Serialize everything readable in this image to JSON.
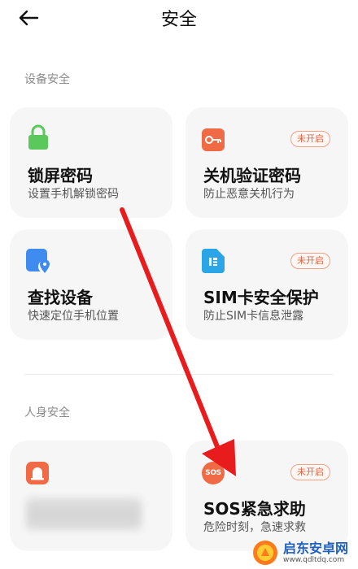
{
  "header": {
    "title": "安全"
  },
  "sections": [
    {
      "label": "设备安全"
    },
    {
      "label": "人身安全"
    }
  ],
  "cards": [
    {
      "title": "锁屏密码",
      "desc": "设置手机解锁密码",
      "badge": null,
      "icon": "lock-icon",
      "color": "#5ac85a"
    },
    {
      "title": "关机验证密码",
      "desc": "防止恶意关机行为",
      "badge": "未开启",
      "icon": "key-icon",
      "color": "#ef6a45"
    },
    {
      "title": "查找设备",
      "desc": "快速定位手机位置",
      "badge": null,
      "icon": "find-device-icon",
      "color": "#3f8bf0"
    },
    {
      "title": "SIM卡安全保护",
      "desc": "防止SIM卡信息泄露",
      "badge": "未开启",
      "icon": "sim-card-icon",
      "color": "#2aa6e8"
    },
    {
      "title": "",
      "desc": "",
      "badge": null,
      "icon": "alert-bell-icon",
      "color": "#ef6a45"
    },
    {
      "title": "SOS紧急求助",
      "desc": "危险时刻，急速求救",
      "badge": "未开启",
      "icon": "sos-icon",
      "color": "#ef6a45",
      "icon_text": "SOS"
    }
  ],
  "annotation": {
    "type": "red-arrow",
    "color": "#e81c1c"
  },
  "watermark": {
    "main": "启东安卓网",
    "sub": "www.qdltdq.com"
  }
}
